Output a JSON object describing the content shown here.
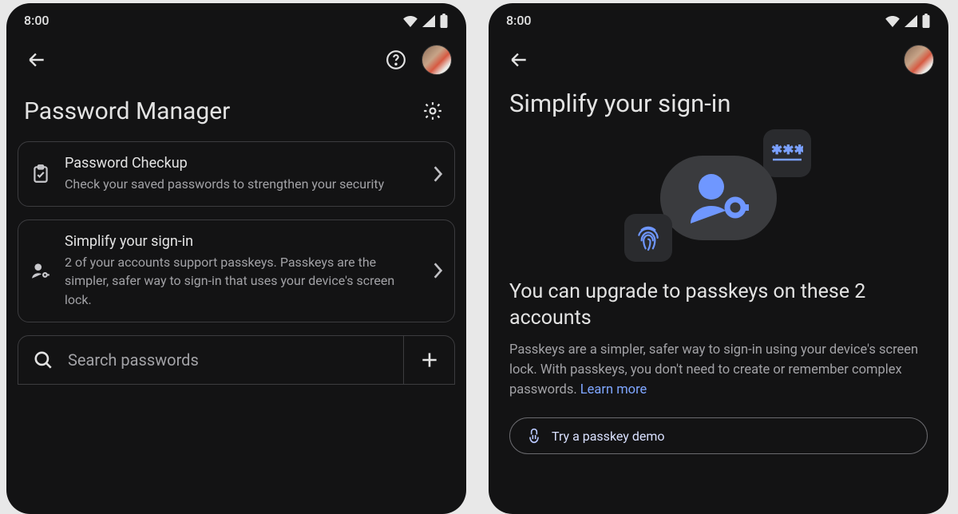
{
  "statusTime": "8:00",
  "left": {
    "title": "Password Manager",
    "cards": [
      {
        "title": "Password Checkup",
        "subtitle": "Check your saved passwords to strengthen your security"
      },
      {
        "title": "Simplify your sign-in",
        "subtitle": "2 of your accounts support passkeys. Passkeys are the simpler, safer way to sign-in that uses your device's screen lock."
      }
    ],
    "searchPlaceholder": "Search passwords"
  },
  "right": {
    "heroTitle": "Simplify your sign-in",
    "sectionTitle": "You can upgrade to passkeys on these 2 accounts",
    "sectionBody": "Passkeys are a simpler, safer way to sign-in using your device's screen lock. With passkeys, you don't need to create or remember complex passwords. ",
    "learnMore": "Learn more",
    "demoButton": "Try a passkey demo"
  }
}
